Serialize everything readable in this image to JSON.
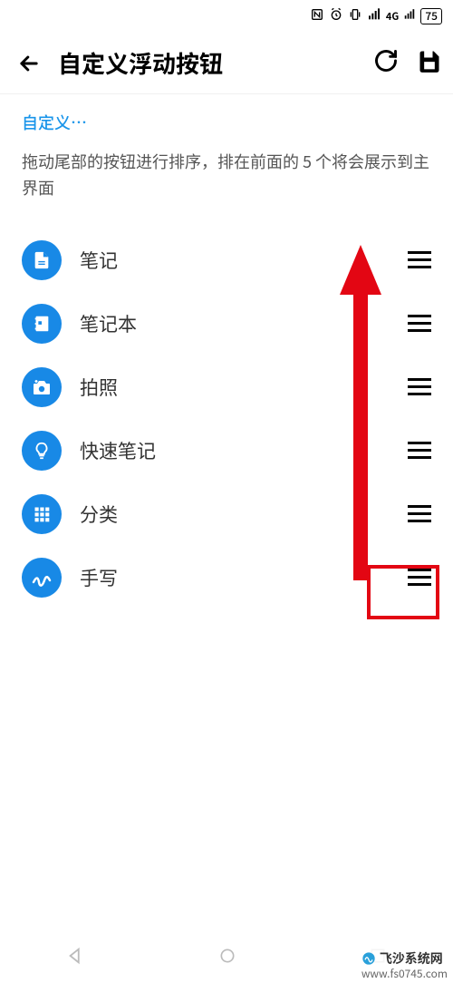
{
  "status_bar": {
    "nfc": "N",
    "alarm": "⏰",
    "vibrate": "📳",
    "signal": "4G",
    "battery_pct": "75"
  },
  "toolbar": {
    "back_icon": "←",
    "title": "自定义浮动按钮",
    "refresh_icon": "refresh",
    "save_icon": "save"
  },
  "crumb": "自定义…",
  "hint": "拖动尾部的按钮进行排序，排在前面的 5 个将会展示到主界面",
  "items": [
    {
      "icon": "note",
      "label": "笔记"
    },
    {
      "icon": "notebook",
      "label": "笔记本"
    },
    {
      "icon": "camera",
      "label": "拍照"
    },
    {
      "icon": "bulb",
      "label": "快速笔记"
    },
    {
      "icon": "grid",
      "label": "分类"
    },
    {
      "icon": "writing",
      "label": "手写"
    }
  ],
  "accent_color": "#1889e6",
  "watermark": {
    "brand": "飞沙系统网",
    "url": "www.fs0745.com"
  }
}
